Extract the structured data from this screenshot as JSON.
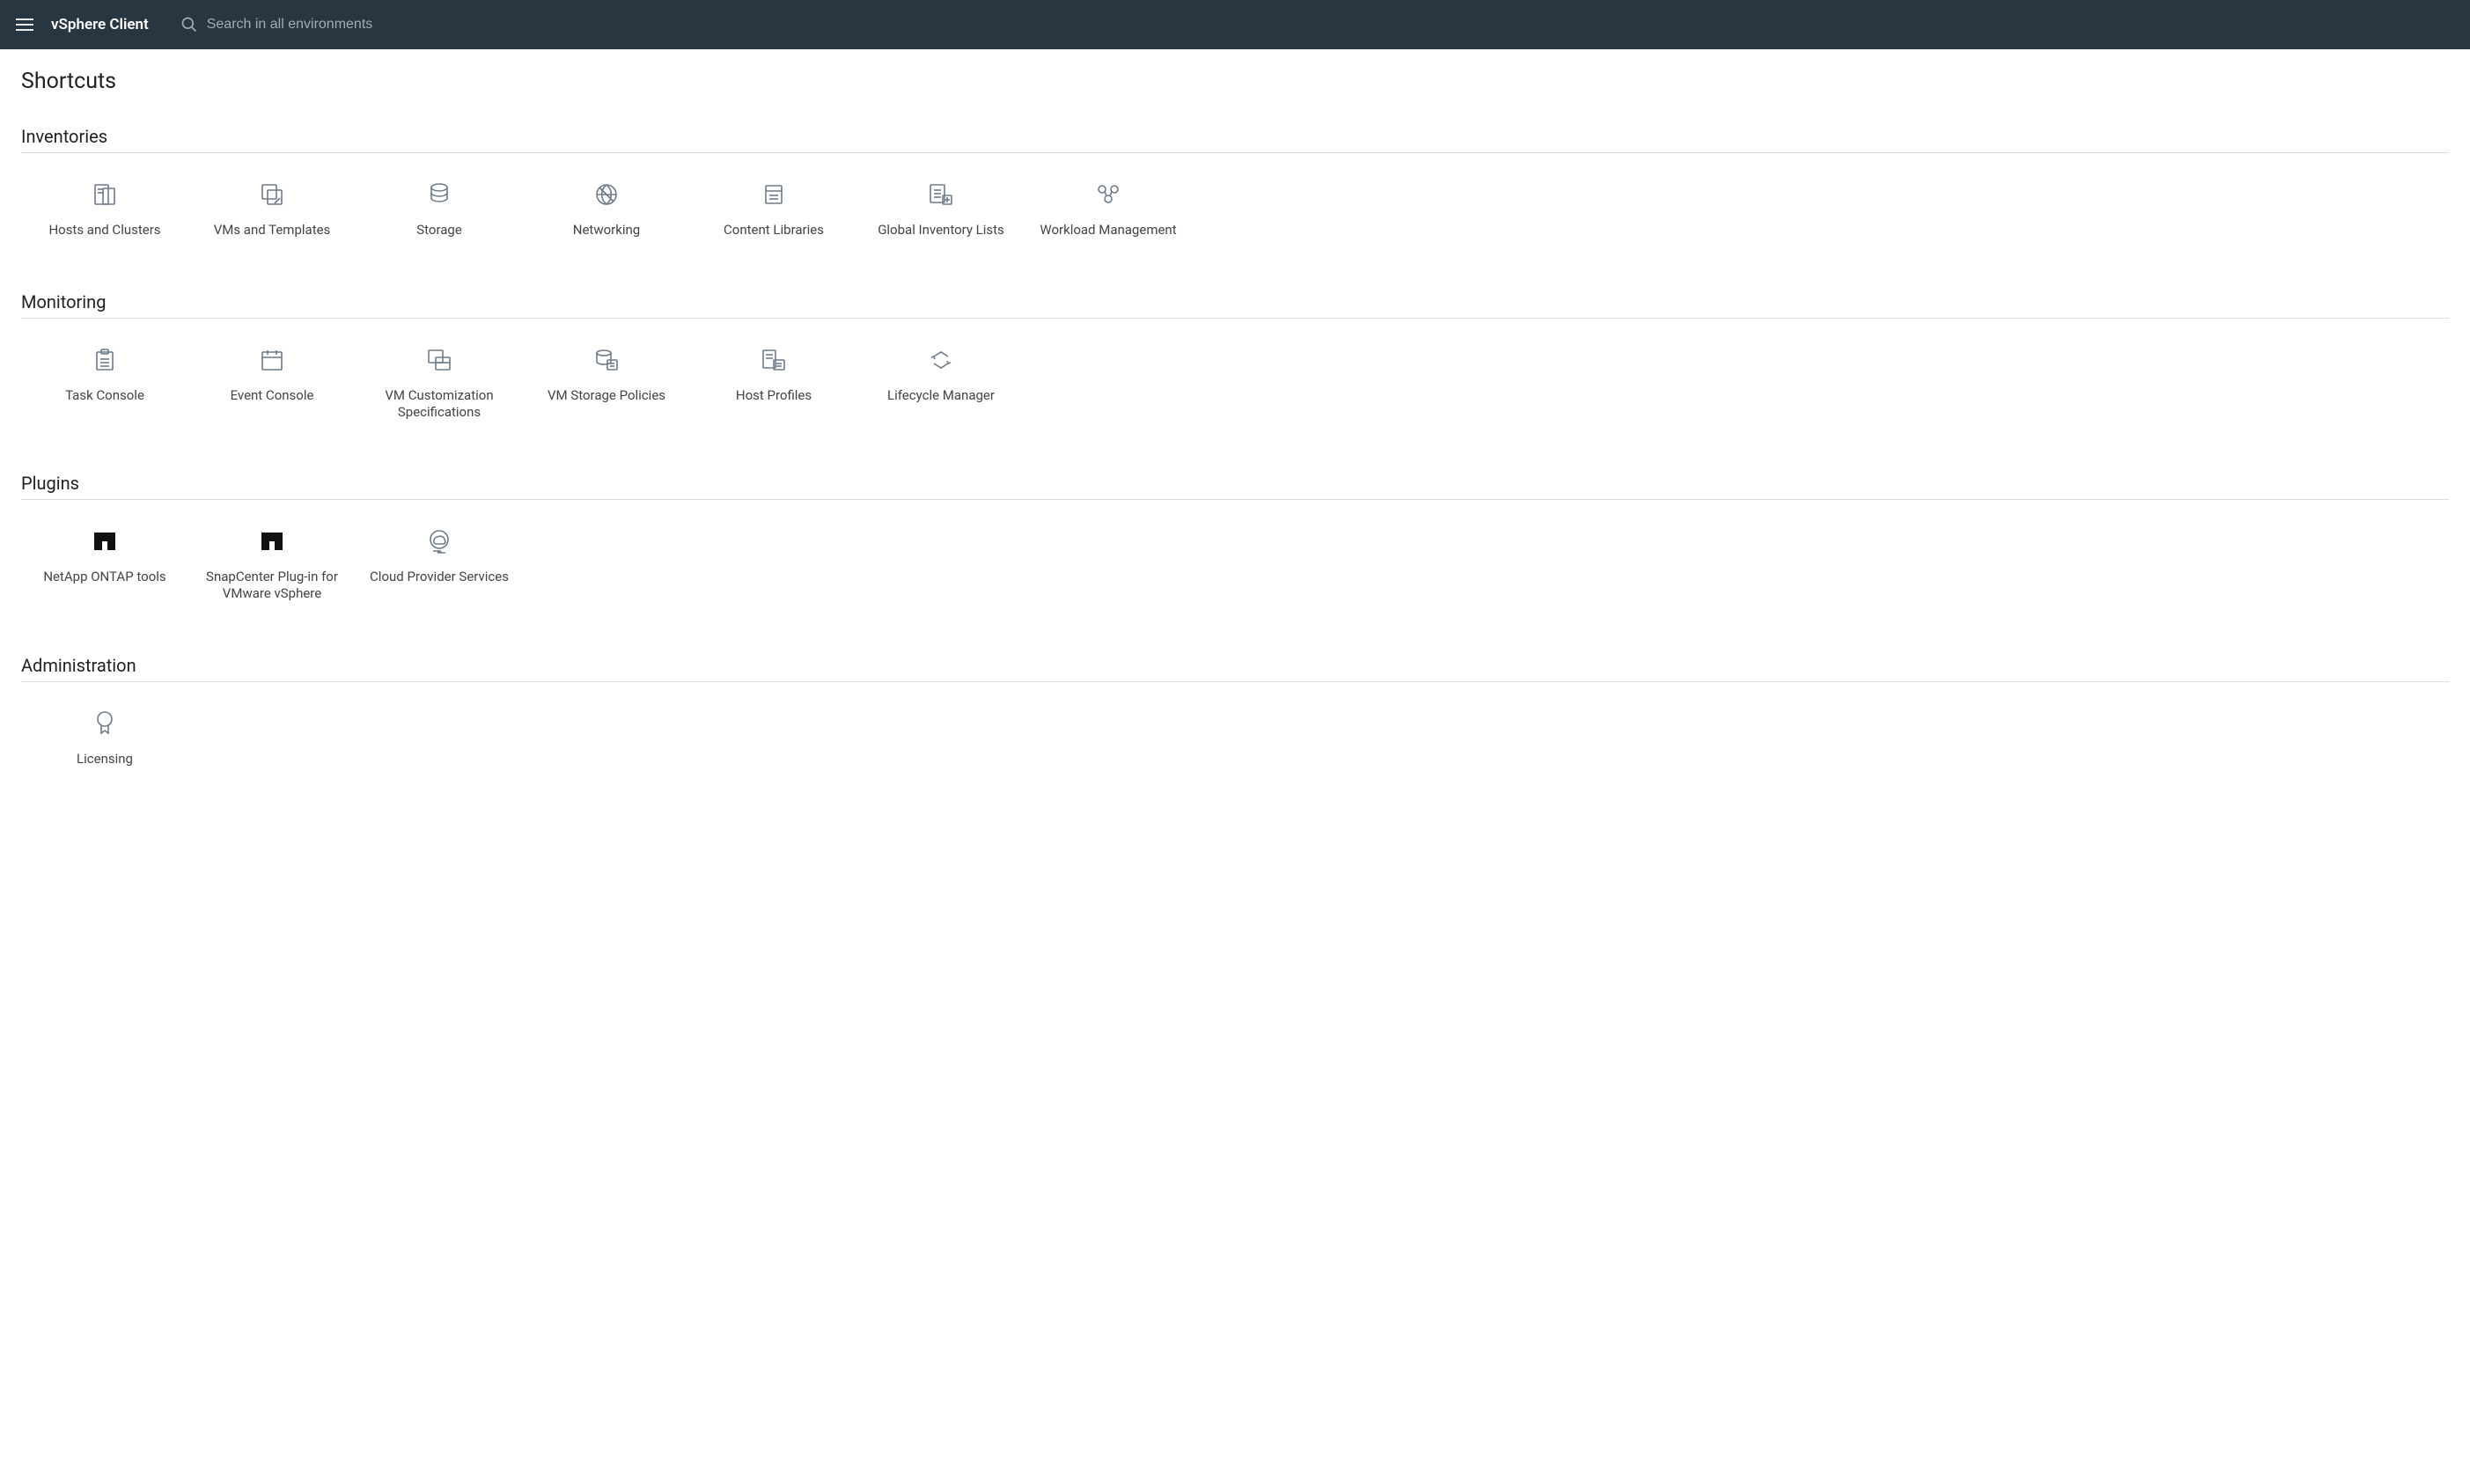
{
  "header": {
    "app_title": "vSphere Client",
    "search_placeholder": "Search in all environments"
  },
  "page": {
    "title": "Shortcuts"
  },
  "sections": {
    "inventories": {
      "title": "Inventories",
      "items": [
        {
          "label": "Hosts and Clusters",
          "icon": "hosts-clusters-icon"
        },
        {
          "label": "VMs and Templates",
          "icon": "vms-templates-icon"
        },
        {
          "label": "Storage",
          "icon": "storage-icon"
        },
        {
          "label": "Networking",
          "icon": "networking-icon"
        },
        {
          "label": "Content Libraries",
          "icon": "content-libraries-icon"
        },
        {
          "label": "Global Inventory Lists",
          "icon": "global-inventory-icon"
        },
        {
          "label": "Workload Management",
          "icon": "workload-management-icon"
        }
      ]
    },
    "monitoring": {
      "title": "Monitoring",
      "items": [
        {
          "label": "Task Console",
          "icon": "task-console-icon"
        },
        {
          "label": "Event Console",
          "icon": "event-console-icon"
        },
        {
          "label": "VM Customization Specifications",
          "icon": "vm-customization-icon"
        },
        {
          "label": "VM Storage Policies",
          "icon": "vm-storage-policies-icon"
        },
        {
          "label": "Host Profiles",
          "icon": "host-profiles-icon"
        },
        {
          "label": "Lifecycle Manager",
          "icon": "lifecycle-manager-icon"
        }
      ]
    },
    "plugins": {
      "title": "Plugins",
      "items": [
        {
          "label": "NetApp ONTAP tools",
          "icon": "netapp-icon"
        },
        {
          "label": "SnapCenter Plug-in for VMware vSphere",
          "icon": "snapcenter-icon"
        },
        {
          "label": "Cloud Provider Services",
          "icon": "cloud-provider-icon"
        }
      ]
    },
    "administration": {
      "title": "Administration",
      "items": [
        {
          "label": "Licensing",
          "icon": "licensing-icon"
        }
      ]
    }
  }
}
